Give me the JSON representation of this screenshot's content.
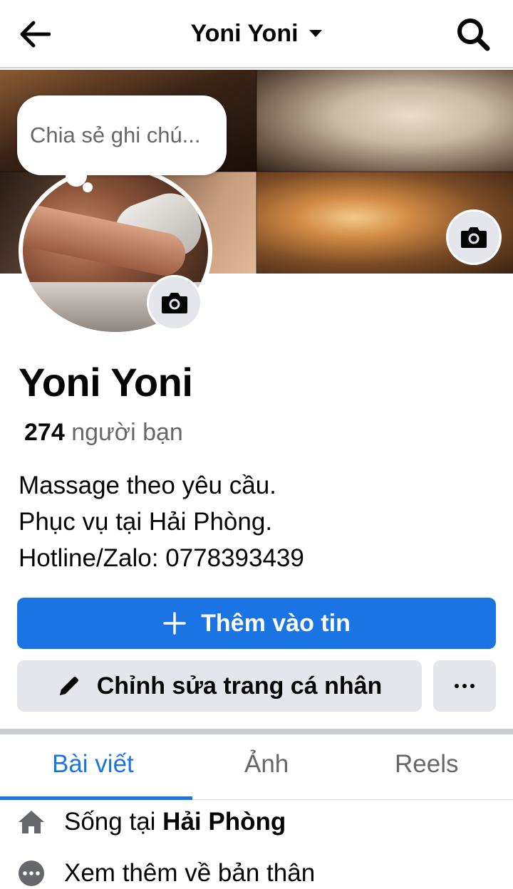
{
  "header": {
    "title": "Yoni Yoni"
  },
  "note": {
    "placeholder": "Chia sẻ ghi chú..."
  },
  "profile": {
    "name": "Yoni Yoni",
    "friends_count": "274",
    "friends_label": "người bạn",
    "bio": [
      "Massage theo yêu cầu.",
      "Phục vụ tại Hải Phòng.",
      "Hotline/Zalo: 0778393439"
    ]
  },
  "actions": {
    "add_story": "Thêm vào tin",
    "edit_profile": "Chỉnh sửa trang cá nhân"
  },
  "tabs": [
    {
      "label": "Bài viết",
      "active": true
    },
    {
      "label": "Ảnh",
      "active": false
    },
    {
      "label": "Reels",
      "active": false
    }
  ],
  "details": {
    "lives_prefix": "Sống tại",
    "lives_city": "Hải Phòng",
    "see_more": "Xem thêm về bản thân"
  },
  "colors": {
    "accent": "#1b74e4",
    "secondary_button": "#e4e6eb",
    "muted_text": "#65676b"
  },
  "icons": [
    "arrow-left-icon",
    "caret-down-icon",
    "search-icon",
    "camera-icon",
    "plus-icon",
    "pencil-icon",
    "more-dots-icon",
    "home-icon",
    "more-circle-icon"
  ]
}
